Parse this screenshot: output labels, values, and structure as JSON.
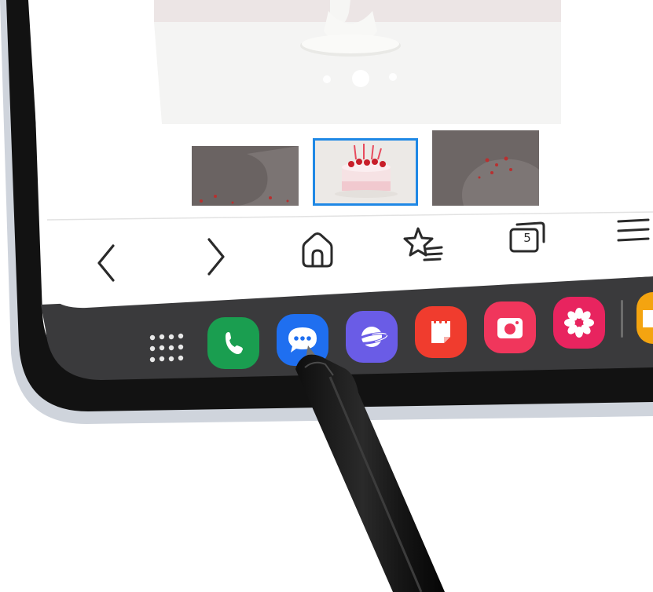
{
  "browser": {
    "nav_bar": {
      "back": {
        "icon": "chevron-left-icon"
      },
      "forward": {
        "icon": "chevron-right-icon"
      },
      "home": {
        "icon": "home-icon"
      },
      "bookmarks": {
        "icon": "star-list-icon"
      },
      "tabs": {
        "icon": "tabs-icon",
        "count": "5"
      },
      "menu": {
        "icon": "hamburger-menu-icon"
      }
    },
    "carousel": {
      "active_dot_index": 1,
      "dot_count": 3,
      "thumbnails": [
        {
          "name": "cake-thumbnail-1",
          "selected": false
        },
        {
          "name": "cake-thumbnail-2",
          "selected": true
        },
        {
          "name": "cake-thumbnail-3",
          "selected": false
        }
      ]
    }
  },
  "dock": {
    "apps": [
      {
        "name": "phone",
        "icon": "phone-icon",
        "color": "#1a9e50"
      },
      {
        "name": "messages",
        "icon": "chat-bubble-icon",
        "color": "#1f6ff0"
      },
      {
        "name": "internet",
        "icon": "planet-icon",
        "color": "#6a5ce6"
      },
      {
        "name": "notes",
        "icon": "note-icon",
        "color": "#f03c2e"
      },
      {
        "name": "camera",
        "icon": "camera-icon",
        "color": "#f0365c"
      },
      {
        "name": "gallery",
        "icon": "flower-icon",
        "color": "#e8245f"
      },
      {
        "name": "my-files",
        "icon": "folder-icon",
        "color": "#f4a410"
      }
    ],
    "app_drawer": {
      "icon": "app-grid-icon"
    }
  },
  "colors": {
    "frame": "#111111",
    "bezel": "#c9ced6",
    "screen_bg": "#ffffff",
    "dock_bg": "#3b3b3d",
    "accent_selected": "#1f88e5"
  }
}
